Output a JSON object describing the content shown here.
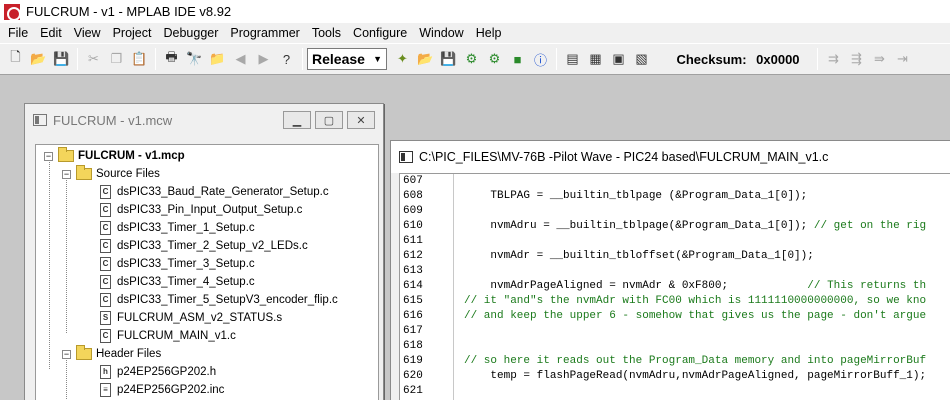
{
  "window": {
    "title": "FULCRUM - v1 - MPLAB IDE v8.92"
  },
  "menu": [
    "File",
    "Edit",
    "View",
    "Project",
    "Debugger",
    "Programmer",
    "Tools",
    "Configure",
    "Window",
    "Help"
  ],
  "toolbar": {
    "config": "Release",
    "checksum_label": "Checksum:",
    "checksum_value": "0x0000"
  },
  "project_window": {
    "title": "FULCRUM - v1.mcw",
    "root": "FULCRUM - v1.mcp",
    "source_label": "Source Files",
    "source_files": [
      "dsPIC33_Baud_Rate_Generator_Setup.c",
      "dsPIC33_Pin_Input_Output_Setup.c",
      "dsPIC33_Timer_1_Setup.c",
      "dsPIC33_Timer_2_Setup_v2_LEDs.c",
      "dsPIC33_Timer_3_Setup.c",
      "dsPIC33_Timer_4_Setup.c",
      "dsPIC33_Timer_5_SetupV3_encoder_flip.c",
      "FULCRUM_ASM_v2_STATUS.s",
      "FULCRUM_MAIN_v1.c"
    ],
    "header_label": "Header Files",
    "header_files": [
      "p24EP256GP202.h",
      "p24EP256GP202.inc"
    ]
  },
  "code_window": {
    "title": "C:\\PIC_FILES\\MV-76B -Pilot Wave - PIC24 based\\FULCRUM_MAIN_v1.c",
    "lines": [
      {
        "n": "607",
        "code": "",
        "comment": ""
      },
      {
        "n": "608",
        "code": "    TBLPAG = __builtin_tblpage (&Program_Data_1[0]);",
        "comment": ""
      },
      {
        "n": "609",
        "code": "",
        "comment": ""
      },
      {
        "n": "610",
        "code": "    nvmAdru = __builtin_tblpage(&Program_Data_1[0]); ",
        "comment": "// get on the rig"
      },
      {
        "n": "611",
        "code": "",
        "comment": ""
      },
      {
        "n": "612",
        "code": "    nvmAdr = __builtin_tbloffset(&Program_Data_1[0]);",
        "comment": ""
      },
      {
        "n": "613",
        "code": "",
        "comment": ""
      },
      {
        "n": "614",
        "code": "    nvmAdrPageAligned = nvmAdr & 0xF800;            ",
        "comment": "// This returns th"
      },
      {
        "n": "615",
        "code": "",
        "comment": "// it \"and\"s the nvmAdr with FC00 which is 1111110000000000, so we kno"
      },
      {
        "n": "616",
        "code": "",
        "comment": "// and keep the upper 6 - somehow that gives us the page - don't argue"
      },
      {
        "n": "617",
        "code": "",
        "comment": ""
      },
      {
        "n": "618",
        "code": "",
        "comment": ""
      },
      {
        "n": "619",
        "code": "",
        "comment": "// so here it reads out the Program_Data memory and into pageMirrorBuf"
      },
      {
        "n": "620",
        "code": "    temp = flashPageRead(nvmAdru,nvmAdrPageAligned, pageMirrorBuff_1);",
        "comment": ""
      },
      {
        "n": "621",
        "code": "",
        "comment": ""
      }
    ]
  }
}
